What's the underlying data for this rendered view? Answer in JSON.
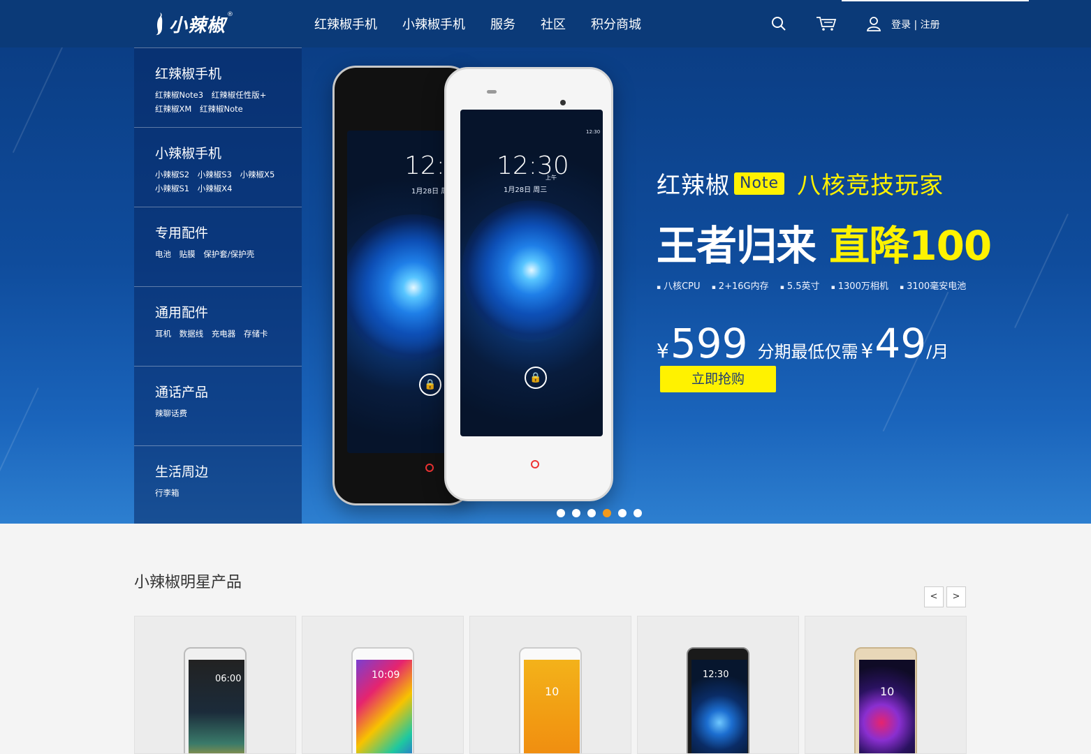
{
  "header": {
    "logo_text": "小辣椒",
    "logo_mark": "®",
    "nav": [
      "红辣椒手机",
      "小辣椒手机",
      "服务",
      "社区",
      "积分商城"
    ],
    "login_label": "登录",
    "divider": " | ",
    "register_label": "注册",
    "icons": [
      "search-icon",
      "cart-icon",
      "user-icon"
    ]
  },
  "sidebar": {
    "categories": [
      {
        "title": "红辣椒手机",
        "links": [
          "红辣椒Note3",
          "红辣椒任性版+",
          "红辣椒XM",
          "红辣椒Note"
        ]
      },
      {
        "title": "小辣椒手机",
        "links": [
          "小辣椒S2",
          "小辣椒S3",
          "小辣椒X5",
          "小辣椒S1",
          "小辣椒X4"
        ]
      },
      {
        "title": "专用配件",
        "links": [
          "电池",
          "贴膜",
          "保护套/保护壳"
        ]
      },
      {
        "title": "通用配件",
        "links": [
          "耳机",
          "数据线",
          "充电器",
          "存储卡"
        ]
      },
      {
        "title": "通话产品",
        "links": [
          "辣聊话费"
        ]
      },
      {
        "title": "生活周边",
        "links": [
          "行李箱"
        ]
      }
    ]
  },
  "hero": {
    "brand": "红辣椒",
    "model_tag": "Note",
    "tagline": "八核竞技玩家",
    "headline_white": "王者归来",
    "headline_yellow": "直降100",
    "specs": [
      "八核CPU",
      "2+16G内存",
      "5.5英寸",
      "1300万相机",
      "3100毫安电池"
    ],
    "currency": "¥",
    "price": "599",
    "installment_label": "分期最低仅需",
    "monthly": "49",
    "per_month": "/月",
    "cta": "立即抢购",
    "phone_time": "12:30",
    "phone_date": "1月28日 周三",
    "phone_ampm": "上午",
    "phone_status_time": "12:30",
    "slides_total": 6,
    "active_slide": 4,
    "colors": {
      "accent_yellow": "#fff200",
      "active_dot": "#f39a1c",
      "header_bg": "#0b3a78"
    }
  },
  "products": {
    "section_title": "小辣椒明星产品",
    "prev_label": "<",
    "next_label": ">",
    "cards": [
      {
        "name": "phone-card-1",
        "screen_time": "06:00"
      },
      {
        "name": "phone-card-2",
        "screen_time": "10:09"
      },
      {
        "name": "phone-card-3",
        "screen_time": "10"
      },
      {
        "name": "phone-card-4",
        "screen_time": "12:30"
      },
      {
        "name": "phone-card-5",
        "screen_time": "10"
      }
    ]
  }
}
